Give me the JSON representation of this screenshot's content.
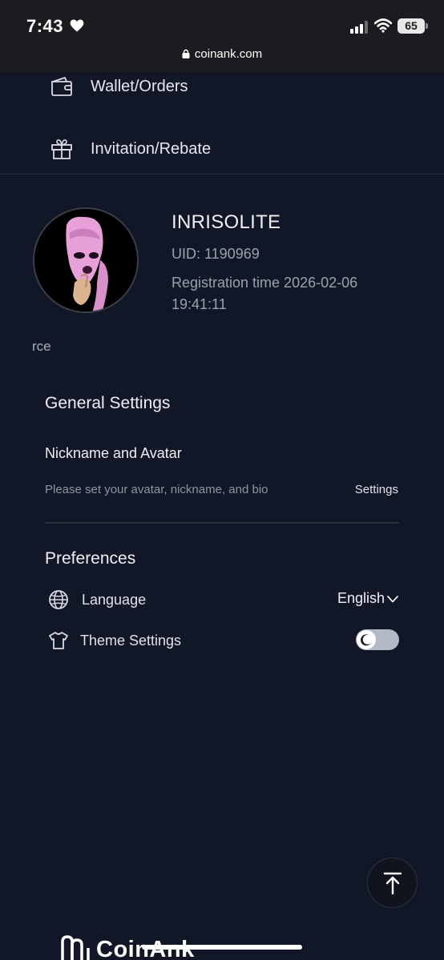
{
  "status_bar": {
    "time": "7:43",
    "battery": "65",
    "url": "coinank.com"
  },
  "menu": {
    "items": [
      {
        "label": "Wallet/Orders",
        "icon": "wallet-icon"
      },
      {
        "label": "Invitation/Rebate",
        "icon": "gift-icon"
      }
    ]
  },
  "profile": {
    "username": "INRISOLITE",
    "uid": "UID: 1190969",
    "registration": "Registration time 2026-02-06 19:41:11",
    "fragment": "rce"
  },
  "general_settings": {
    "title": "General Settings",
    "nickname_title": "Nickname and Avatar",
    "nickname_desc": "Please set your avatar, nickname, and bio",
    "settings_link": "Settings"
  },
  "preferences": {
    "title": "Preferences",
    "language_label": "Language",
    "language_value": "English",
    "theme_label": "Theme Settings",
    "theme_mode": "dark"
  },
  "footer": {
    "brand": "CoinAnk"
  },
  "colors": {
    "background": "#111726",
    "status_bar": "#1a1c1f",
    "text_primary": "#eef0f4",
    "text_secondary": "#9aa1ae",
    "avatar_pink": "#e8a0d8"
  }
}
